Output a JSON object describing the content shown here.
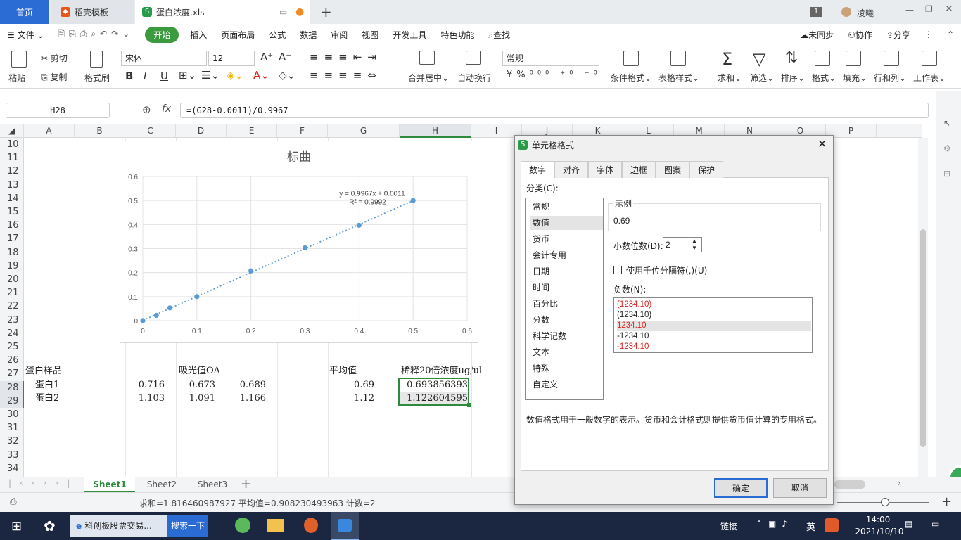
{
  "titlebar": {
    "home_tab": "首页",
    "template_tab": "稻壳模板",
    "file_tab": "蛋白浓度.xls",
    "user": "凌曦",
    "badge": "1"
  },
  "menubar": {
    "file": "文件",
    "items": [
      "开始",
      "插入",
      "页面布局",
      "公式",
      "数据",
      "审阅",
      "视图",
      "开发工具",
      "特色功能"
    ],
    "search": "查找",
    "unsync": "未同步",
    "collab": "协作",
    "share": "分享"
  },
  "ribbon": {
    "paste": "粘贴",
    "cut": "剪切",
    "copy": "复制",
    "format_painter": "格式刷",
    "font_name": "宋体",
    "font_size": "12",
    "number_format": "常规",
    "merge": "合并居中",
    "wrap": "自动换行",
    "conditional": "条件格式",
    "table_style": "表格样式",
    "sum": "求和",
    "filter": "筛选",
    "sort": "排序",
    "format": "格式",
    "fill": "填充",
    "rowcol": "行和列",
    "sheet": "工作表"
  },
  "formula_bar": {
    "cell_ref": "H28",
    "fx": "fx",
    "formula": "=(G28-0.0011)/0.9967"
  },
  "columns": [
    "A",
    "B",
    "C",
    "D",
    "E",
    "F",
    "G",
    "H",
    "I",
    "J",
    "K",
    "L",
    "M",
    "N",
    "O",
    "P"
  ],
  "rows": [
    "10",
    "11",
    "12",
    "13",
    "14",
    "15",
    "16",
    "17",
    "18",
    "19",
    "20",
    "21",
    "22",
    "23",
    "24",
    "25",
    "26",
    "27",
    "28",
    "29",
    "30",
    "31",
    "32",
    "33",
    "34"
  ],
  "cells": {
    "a27": "蛋白样品",
    "d27": "吸光值OA",
    "g27": "平均值",
    "h27": "稀释20倍浓度ug/ul",
    "a28": "蛋白1",
    "c28": "0.716",
    "d28": "0.673",
    "e28": "0.689",
    "g28": "0.69",
    "h28": "0.693856393",
    "a29": "蛋白2",
    "c29": "1.103",
    "d29": "1.091",
    "e29": "1.166",
    "g29": "1.12",
    "h29": "1.122604595"
  },
  "chart_data": {
    "type": "scatter",
    "title": "标曲",
    "x": [
      0,
      0.025,
      0.05,
      0.1,
      0.2,
      0.3,
      0.4,
      0.5
    ],
    "y": [
      0,
      0.022,
      0.053,
      0.1,
      0.207,
      0.303,
      0.397,
      0.5
    ],
    "xlim": [
      0,
      0.6
    ],
    "ylim": [
      0,
      0.6
    ],
    "xticks": [
      "0",
      "0.1",
      "0.2",
      "0.3",
      "0.4",
      "0.5",
      "0.6"
    ],
    "yticks": [
      "0",
      "0.1",
      "0.2",
      "0.3",
      "0.4",
      "0.5",
      "0.6"
    ],
    "trendline_equation": "y = 0.9967x + 0.0011",
    "r_squared": "R² = 0.9992",
    "trendline": {
      "slope": 0.9967,
      "intercept": 0.0011
    },
    "color": "#5b9bd5",
    "grid": true
  },
  "sheet_tabs": [
    "Sheet1",
    "Sheet2",
    "Sheet3"
  ],
  "statusbar": {
    "text": "求和=1.816460987927  平均值=0.908230493963  计数=2"
  },
  "dialog": {
    "title": "单元格格式",
    "tabs": [
      "数字",
      "对齐",
      "字体",
      "边框",
      "图案",
      "保护"
    ],
    "category_label": "分类(C):",
    "categories": [
      "常规",
      "数值",
      "货币",
      "会计专用",
      "日期",
      "时间",
      "百分比",
      "分数",
      "科学记数",
      "文本",
      "特殊",
      "自定义"
    ],
    "sample_label": "示例",
    "sample_value": "0.69",
    "decimal_label": "小数位数(D):",
    "decimal_value": "2",
    "thousands_label": "使用千位分隔符(,)(U)",
    "negative_label": "负数(N):",
    "negative_options": [
      "(1234.10)",
      "(1234.10)",
      "1234.10",
      "-1234.10",
      "-1234.10"
    ],
    "description": "数值格式用于一般数字的表示。货币和会计格式则提供货币值计算的专用格式。",
    "ok": "确定",
    "cancel": "取消"
  },
  "taskbar": {
    "browser_item": "科创板股票交易...",
    "search_btn": "搜索一下",
    "link": "链接",
    "lang": "英",
    "time": "14:00",
    "date": "2021/10/10"
  }
}
